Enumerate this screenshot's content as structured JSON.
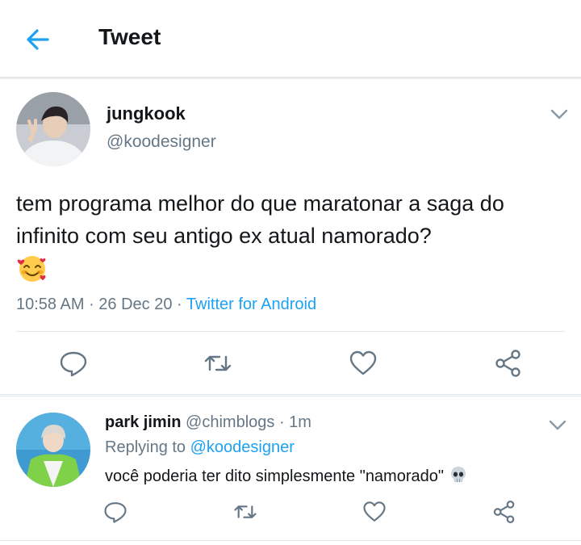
{
  "header": {
    "title": "Tweet",
    "back_icon": "arrow-left-icon"
  },
  "tweet": {
    "author_name": "jungkook",
    "author_handle": "@koodesigner",
    "text": "tem programa melhor do que maratonar a saga do infinito com seu antigo ex atual namorado?",
    "emoji": "smiling-face-with-hearts-emoji",
    "time": "10:58 AM",
    "date": "26 Dec 20",
    "source": "Twitter for Android",
    "separator": " · "
  },
  "reply": {
    "author_name": "park jimin",
    "author_handle": "@chimblogs",
    "time_ago": "1m",
    "replying_label": "Replying to",
    "replying_to": "@koodesigner",
    "text": "você poderia ter dito simplesmente \"namorado\"",
    "emoji": "skull-emoji",
    "separator": " · "
  },
  "actions": [
    "reply-icon",
    "retweet-icon",
    "like-icon",
    "share-icon"
  ],
  "colors": {
    "accent": "#1da1f2",
    "secondary_text": "#657786",
    "border": "#e1e8ed",
    "text": "#14171a"
  }
}
